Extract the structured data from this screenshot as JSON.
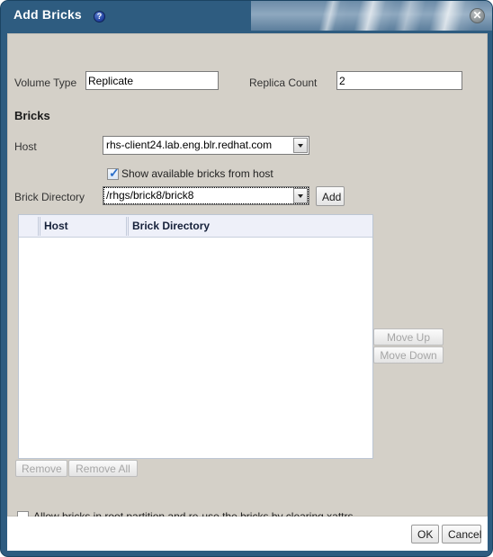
{
  "window": {
    "title": "Add Bricks",
    "help_icon": "help-icon",
    "close_icon": "✕"
  },
  "form": {
    "volume_type_label": "Volume Type",
    "volume_type_value": "Replicate",
    "replica_count_label": "Replica Count",
    "replica_count_value": "2"
  },
  "bricks": {
    "heading": "Bricks",
    "host_label": "Host",
    "host_value": "rhs-client24.lab.eng.blr.redhat.com",
    "show_available_label": "Show available bricks from host",
    "show_available_checked": true,
    "brick_directory_label": "Brick Directory",
    "brick_directory_value": "/rhgs/brick8/brick8",
    "add_label": "Add"
  },
  "table": {
    "columns": [
      "",
      "Host",
      "Brick Directory"
    ],
    "rows": []
  },
  "side_buttons": {
    "move_up_label": "Move Up",
    "move_down_label": "Move Down"
  },
  "list_buttons": {
    "remove_label": "Remove",
    "remove_all_label": "Remove All"
  },
  "options": {
    "allow_root_label": "Allow bricks in root partition and re-use the bricks by clearing xattrs",
    "allow_root_checked": false
  },
  "footer": {
    "ok_label": "OK",
    "cancel_label": "Cancel"
  },
  "colors": {
    "title_bar": "#2e5c80",
    "panel": "#d4d0c8",
    "table_header": "#eef0f9",
    "accent": "#2a6fc9"
  }
}
